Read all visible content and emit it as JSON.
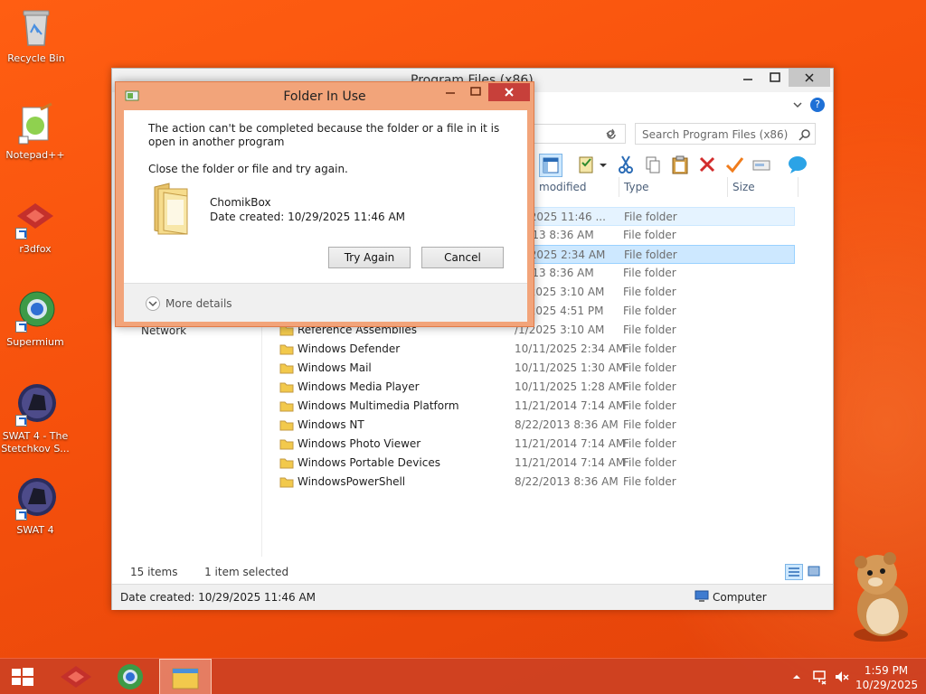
{
  "desktop": {
    "icons": [
      {
        "label": "Recycle Bin",
        "icon": "recycle-bin-icon"
      },
      {
        "label": "Notepad++",
        "icon": "notepadpp-icon"
      },
      {
        "label": "r3dfox",
        "icon": "r3dfox-icon"
      },
      {
        "label": "Supermium",
        "icon": "supermium-icon"
      },
      {
        "label": "SWAT 4 - The Stetchkov S...",
        "icon": "swat4-stetchkov-icon"
      },
      {
        "label": "SWAT 4",
        "icon": "swat4-icon"
      }
    ]
  },
  "explorer": {
    "title": "Program Files (x86)",
    "search_placeholder": "Search Program Files (x86)",
    "columns": {
      "date": "modified",
      "type": "Type",
      "size": "Size"
    },
    "rows": [
      {
        "name": "",
        "date": "/9/2025 11:46 ...",
        "type": "File folder"
      },
      {
        "name": "",
        "date": "/2013 8:36 AM",
        "type": "File folder"
      },
      {
        "name": "",
        "date": "/1/2025 2:34 AM",
        "type": "File folder"
      },
      {
        "name": "",
        "date": "/2013 8:36 AM",
        "type": "File folder"
      },
      {
        "name": "",
        "date": "/1/2025 3:10 AM",
        "type": "File folder"
      },
      {
        "name": "",
        "date": "/0/2025 4:51 PM",
        "type": "File folder"
      },
      {
        "name": "Reference Assemblies",
        "date": "/1/2025 3:10 AM",
        "type": "File folder"
      },
      {
        "name": "Windows Defender",
        "date": "10/11/2025 2:34 AM",
        "type": "File folder"
      },
      {
        "name": "Windows Mail",
        "date": "10/11/2025 1:30 AM",
        "type": "File folder"
      },
      {
        "name": "Windows Media Player",
        "date": "10/11/2025 1:28 AM",
        "type": "File folder"
      },
      {
        "name": "Windows Multimedia Platform",
        "date": "11/21/2014 7:14 AM",
        "type": "File folder"
      },
      {
        "name": "Windows NT",
        "date": "8/22/2013 8:36 AM",
        "type": "File folder"
      },
      {
        "name": "Windows Photo Viewer",
        "date": "11/21/2014 7:14 AM",
        "type": "File folder"
      },
      {
        "name": "Windows Portable Devices",
        "date": "11/21/2014 7:14 AM",
        "type": "File folder"
      },
      {
        "name": "WindowsPowerShell",
        "date": "8/22/2013 8:36 AM",
        "type": "File folder"
      }
    ],
    "nav_network": "Network",
    "status_items": "15 items",
    "status_selected": "1 item selected",
    "status_date": "Date created: 10/29/2025 11:46 AM",
    "status_location": "Computer"
  },
  "dialog": {
    "title": "Folder In Use",
    "message": "The action can't be completed because the folder or a file in it is open in another program",
    "instruction": "Close the folder or file and try again.",
    "item_name": "ChomikBox",
    "item_date": "Date created: 10/29/2025 11:46 AM",
    "try_again": "Try Again",
    "cancel": "Cancel",
    "more_details": "More details"
  },
  "taskbar": {
    "time": "1:59 PM",
    "date": "10/29/2025"
  },
  "colors": {
    "desktop": "#f5500c",
    "dialog_frame": "#f2a47a",
    "selection": "#cde8ff",
    "taskbar": "#cd4123"
  }
}
